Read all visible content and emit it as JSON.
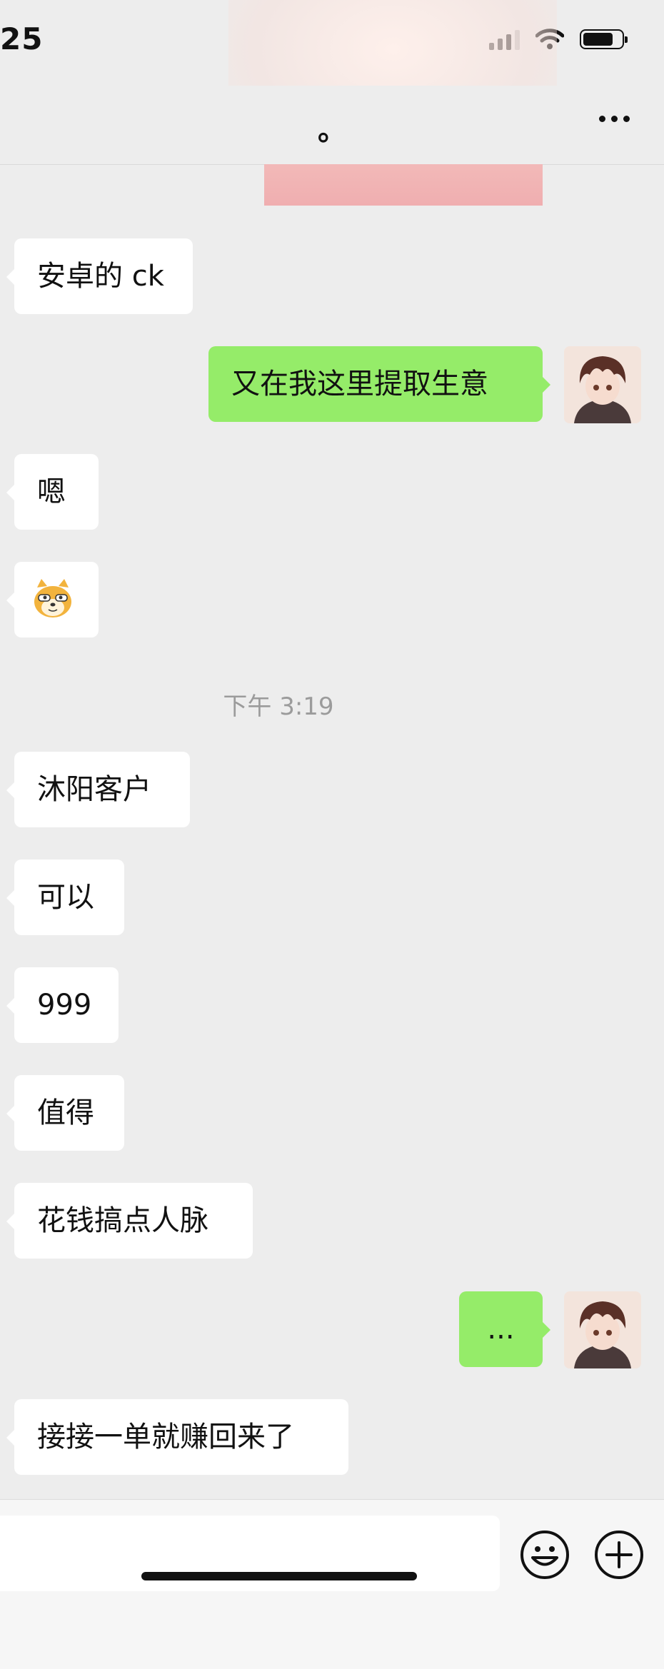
{
  "status_bar": {
    "time": "25"
  },
  "header": {
    "title": "。"
  },
  "messages": [
    {
      "side": "left",
      "text": "安卓的 ck"
    },
    {
      "side": "right",
      "text": "又在我这里提取生意"
    },
    {
      "side": "left",
      "text": "嗯"
    },
    {
      "side": "left",
      "text": "",
      "emoji": "doge-sticker"
    },
    {
      "side": "center",
      "text": "下午 3:19"
    },
    {
      "side": "left",
      "text": "沐阳客户"
    },
    {
      "side": "left",
      "text": "可以"
    },
    {
      "side": "left",
      "text": "999"
    },
    {
      "side": "left",
      "text": "值得"
    },
    {
      "side": "left",
      "text": "花钱搞点人脉"
    },
    {
      "side": "right",
      "text": "..."
    },
    {
      "side": "left",
      "text": "接接一单就赚回来了"
    }
  ],
  "colors": {
    "sent_bubble": "#95ec69",
    "received_bubble": "#ffffff",
    "background": "#ededed"
  },
  "icons": {
    "more": "more-dots-icon",
    "emoji": "smiley-icon",
    "plus": "plus-circle-icon"
  }
}
